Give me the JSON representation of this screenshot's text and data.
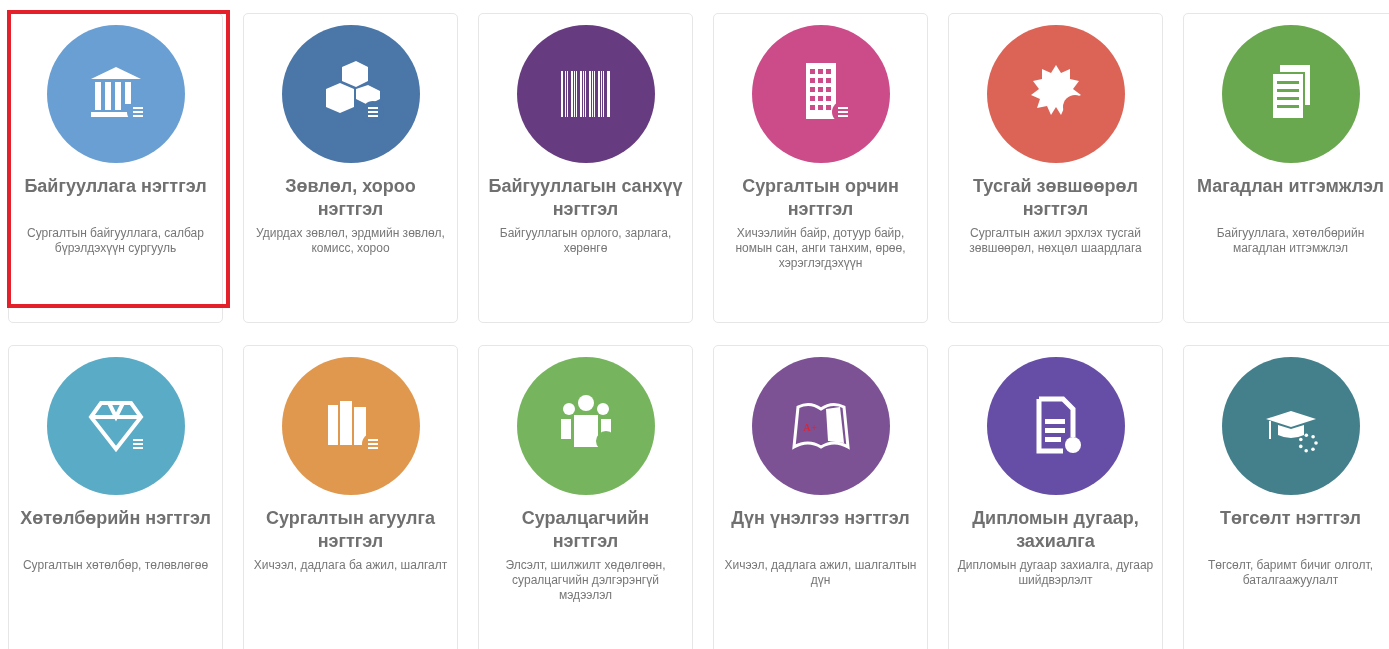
{
  "modules": [
    {
      "title": "Байгууллага нэгтгэл",
      "description": "Сургалтын байгууллага, салбар бүрэлдэхүүн сургууль",
      "color": "#6a9fd3",
      "kind": "bank",
      "selected": true
    },
    {
      "title": "Зөвлөл, хороо нэгтгэл",
      "description": "Удирдах зөвлөл, эрдмийн зөвлөл, комисс, хороо",
      "color": "#4a76a8",
      "kind": "cubes",
      "selected": false
    },
    {
      "title": "Байгууллагын санхүү нэгтгэл",
      "description": "Байгууллагын орлого, зарлага, хөрөнгө",
      "color": "#673b80",
      "kind": "barcode",
      "selected": false
    },
    {
      "title": "Сургалтын орчин нэгтгэл",
      "description": "Хичээлийн байр, дотуур байр, номын сан, анги танхим, өрөө, хэрэглэгдэхүүн",
      "color": "#cc4c8a",
      "kind": "building",
      "selected": false
    },
    {
      "title": "Тусгай зөвшөөрөл нэгтгэл",
      "description": "Сургалтын ажил эрхлэх тусгай зөвшөөрөл, нөхцөл шаардлага",
      "color": "#dc6457",
      "kind": "seal",
      "selected": false
    },
    {
      "title": "Магадлан итгэмжлэл",
      "description": "Байгууллага, хөтөлбөрийн магадлан итгэмжлэл",
      "color": "#6aa84f",
      "kind": "pages",
      "selected": false
    },
    {
      "title": "Хөтөлбөрийн нэгтгэл",
      "description": "Сургалтын хөтөлбөр, төлөвлөгөө",
      "color": "#5aabc6",
      "kind": "diamond",
      "selected": false
    },
    {
      "title": "Сургалтын агуулга нэгтгэл",
      "description": "Хичээл, дадлага ба ажил, шалгалт",
      "color": "#e0984e",
      "kind": "books",
      "selected": false
    },
    {
      "title": "Суралцагчийн нэгтгэл",
      "description": "Элсэлт, шилжилт хөдөлгөөн, суралцагчийн дэлгэрэнгүй мэдээлэл",
      "color": "#76b55e",
      "kind": "people",
      "selected": false
    },
    {
      "title": "Дүн үнэлгээ нэгтгэл",
      "description": "Хичээл, дадлага ажил, шалгалтын дүн",
      "color": "#7c5295",
      "kind": "book",
      "icon_text": "A+",
      "selected": false
    },
    {
      "title": "Дипломын дугаар, захиалга",
      "description": "Дипломын дугаар захиалга, дугаар шийдвэрлэлт",
      "color": "#664ea6",
      "kind": "certificate",
      "selected": false
    },
    {
      "title": "Төгсөлт нэгтгэл",
      "description": "Төгсөлт, баримт бичиг олголт, баталгаажуулалт",
      "color": "#44808c",
      "kind": "graduation",
      "selected": false
    }
  ]
}
